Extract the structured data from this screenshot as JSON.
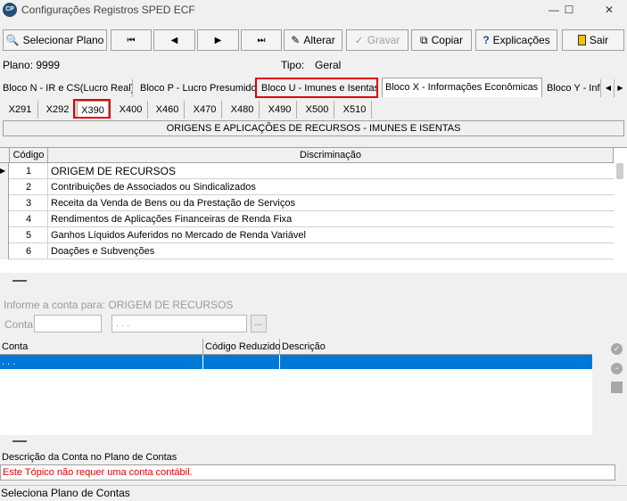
{
  "window": {
    "icon_text": "CP",
    "title": "Configurações Registros SPED ECF",
    "minimize": "—",
    "maximize": "☐",
    "close": "✕"
  },
  "toolbar": {
    "select_plan": "Selecionar Plano",
    "first": "⏮",
    "prev": "◀",
    "next": "▶",
    "last": "⏭",
    "edit": "Alterar",
    "save": "Gravar",
    "copy": "Copiar",
    "explain": "Explicações",
    "exit": "Sair"
  },
  "info": {
    "plano": "Plano: 9999",
    "tipo_label": "Tipo:",
    "tipo_value": "Geral"
  },
  "block_tabs": [
    "Bloco N - IR e CS(Lucro Real)",
    "Bloco P - Lucro Presumido",
    "Bloco U - Imunes e Isentas",
    "Bloco X - Informações  Econômicas",
    "Bloco Y - Informações Gerais"
  ],
  "block_tabs_arrows": {
    "left": "◀",
    "right": "▶"
  },
  "sub_tabs": [
    "X291",
    "X292",
    "X390",
    "X400",
    "X460",
    "X470",
    "X480",
    "X490",
    "X500",
    "X510"
  ],
  "section_title": "ORIGENS E APLICAÇÕES DE RECURSOS - IMUNES E ISENTAS",
  "grid1": {
    "headers": {
      "code": "Código",
      "desc": "Discriminação"
    },
    "current_marker": "▶",
    "rows": [
      {
        "code": "1",
        "desc": "ORIGEM DE RECURSOS"
      },
      {
        "code": "2",
        "desc": "Contribuições de Associados ou Sindicalizados"
      },
      {
        "code": "3",
        "desc": "Receita da Venda de Bens ou da Prestação de Serviços"
      },
      {
        "code": "4",
        "desc": "Rendimentos de Aplicações Financeiras de Renda Fixa"
      },
      {
        "code": "5",
        "desc": "Ganhos Líquidos Auferidos no Mercado de Renda Variável"
      },
      {
        "code": "6",
        "desc": "Doações e Subvenções"
      }
    ]
  },
  "account_input": {
    "prompt": "Informe a conta para: ORIGEM DE RECURSOS",
    "label": "Conta",
    "value": "",
    "name_value": ". . .",
    "browse": "..."
  },
  "grid2": {
    "headers": {
      "conta": "Conta",
      "reduced": "Código Reduzido",
      "desc": "Descrição"
    },
    "row": {
      "conta": ". . .",
      "reduced": "",
      "desc": ""
    }
  },
  "side_icons": {
    "confirm": "✓",
    "remove": "−"
  },
  "description": {
    "label": "Descrição da Conta no Plano de Contas",
    "value": "Este Tópico não requer uma conta contábil."
  },
  "status": "Seleciona Plano de Contas",
  "colors": {
    "highlight": "#e00000",
    "selection": "#0078d7"
  }
}
